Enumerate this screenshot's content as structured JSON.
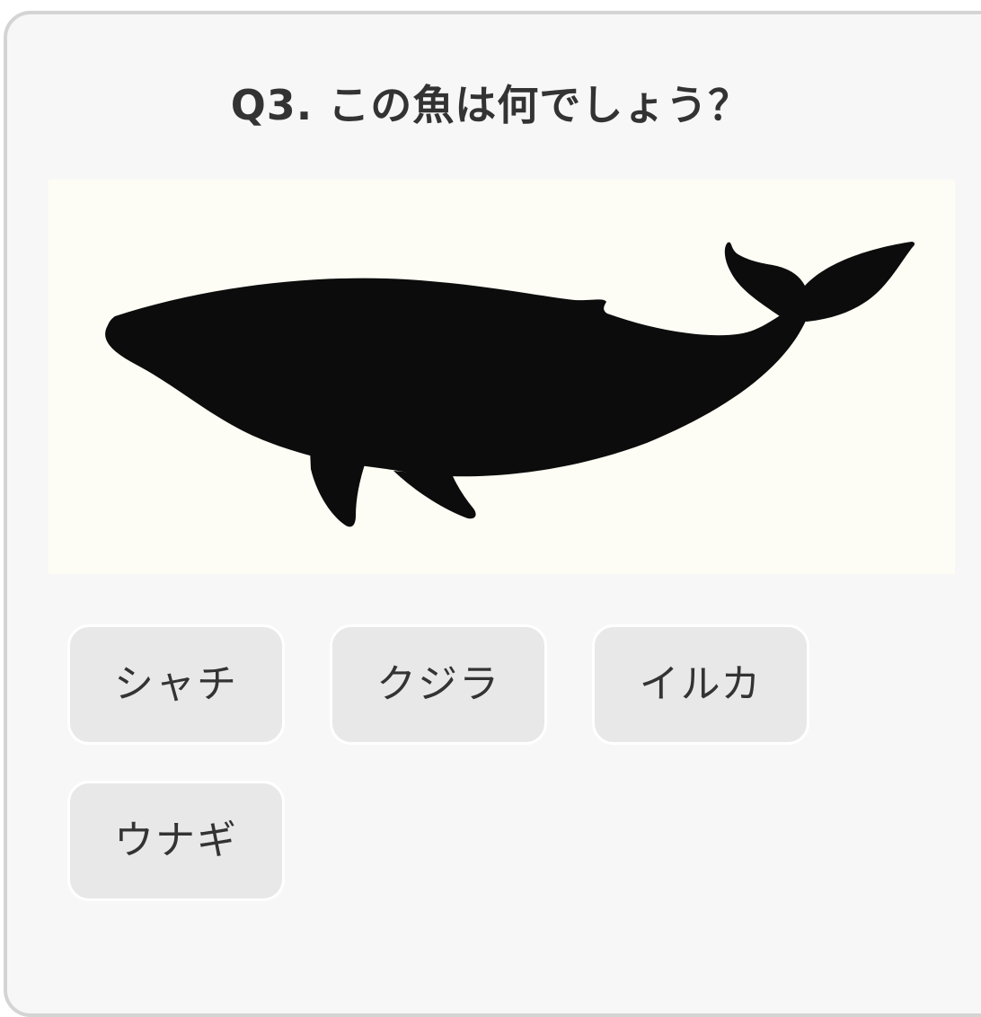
{
  "quiz": {
    "question": "Q3. この魚は何でしょう？",
    "image_icon": "whale-silhouette",
    "answers": [
      "シャチ",
      "クジラ",
      "イルカ",
      "ウナギ"
    ]
  },
  "colors": {
    "card_background": "#f7f7f7",
    "card_border": "#d4d4d4",
    "image_background": "#fdfdf5",
    "silhouette": "#0c0c0c",
    "button_background": "#e8e8e8",
    "text": "#333333"
  }
}
